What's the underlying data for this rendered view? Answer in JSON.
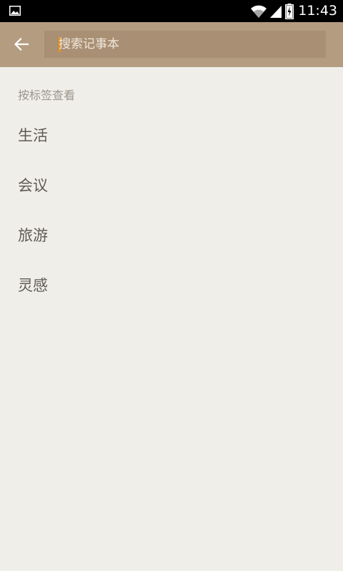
{
  "status_bar": {
    "time": "11:43",
    "icons": [
      "gallery-icon",
      "wifi-icon",
      "signal-icon",
      "battery-charging-icon"
    ]
  },
  "toolbar": {
    "back_icon": "arrow-left-icon",
    "search_placeholder": "搜索记事本",
    "search_value": ""
  },
  "tags": {
    "header": "按标签查看",
    "items": [
      {
        "label": "生活"
      },
      {
        "label": "会议"
      },
      {
        "label": "旅游"
      },
      {
        "label": "灵感"
      }
    ]
  },
  "colors": {
    "toolbar": "#b49c80",
    "search_box": "#a98f74",
    "background": "#efeee8",
    "cursor": "#e8931f",
    "tag_text": "#5f5a53",
    "header_text": "#9c968d"
  }
}
